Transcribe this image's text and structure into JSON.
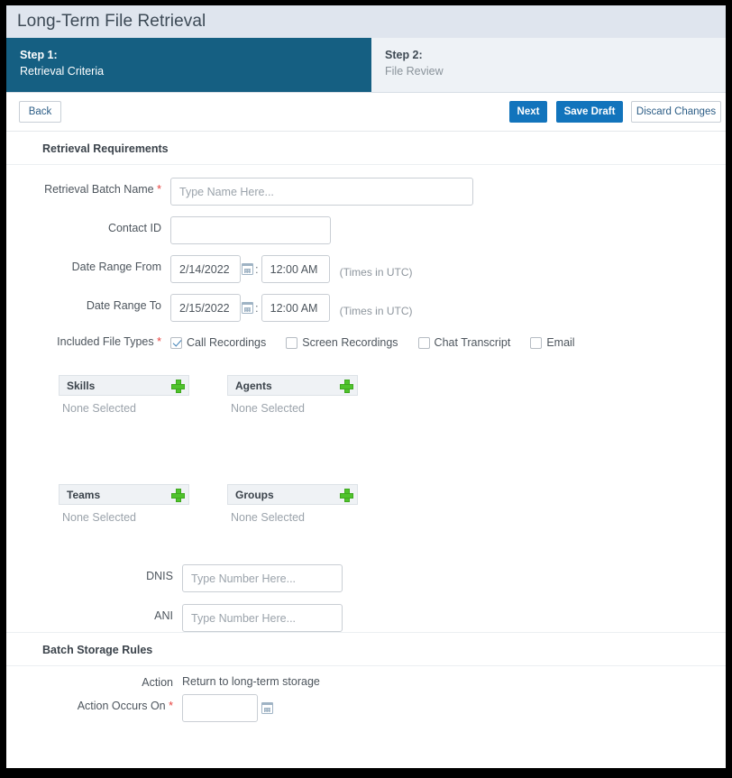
{
  "window": {
    "title": "Long-Term File Retrieval"
  },
  "steps": [
    {
      "num": "Step 1:",
      "name": "Retrieval Criteria",
      "active": true
    },
    {
      "num": "Step 2:",
      "name": "File Review",
      "active": false
    }
  ],
  "toolbar": {
    "back_label": "Back",
    "next_label": "Next",
    "save_draft_label": "Save Draft",
    "discard_label": "Discard Changes"
  },
  "sections": {
    "retrieval": {
      "heading": "Retrieval Requirements",
      "batch_name": {
        "label": "Retrieval Batch Name",
        "required": "*",
        "value": "",
        "placeholder": "Type Name Here..."
      },
      "contact_id": {
        "label": "Contact ID",
        "value": "",
        "placeholder": ""
      },
      "date_from": {
        "label": "Date Range From",
        "date": "2/14/2022",
        "time": "12:00 AM",
        "note": "(Times in UTC)"
      },
      "date_to": {
        "label": "Date Range To",
        "date": "2/15/2022",
        "time": "12:00 AM",
        "note": "(Times in UTC)"
      },
      "file_types": {
        "label": "Included File Types",
        "required": "*",
        "options": [
          {
            "label": "Call Recordings",
            "checked": true
          },
          {
            "label": "Screen Recordings",
            "checked": false
          },
          {
            "label": "Chat Transcript",
            "checked": false
          },
          {
            "label": "Email",
            "checked": false
          }
        ]
      },
      "pickers": [
        {
          "title": "Skills",
          "value": "None Selected"
        },
        {
          "title": "Agents",
          "value": "None Selected"
        },
        {
          "title": "Teams",
          "value": "None Selected"
        },
        {
          "title": "Groups",
          "value": "None Selected"
        }
      ],
      "dnis": {
        "label": "DNIS",
        "value": "",
        "placeholder": "Type Number Here..."
      },
      "ani": {
        "label": "ANI",
        "value": "",
        "placeholder": "Type Number Here..."
      }
    },
    "storage": {
      "heading": "Batch Storage Rules",
      "action": {
        "label": "Action",
        "value": "Return to long-term storage"
      },
      "action_occurs_on": {
        "label": "Action Occurs On",
        "required": "*",
        "value": "",
        "placeholder": ""
      }
    }
  },
  "colors": {
    "title_bar": "#dfe5ee",
    "active_step": "#155f82",
    "inactive_step": "#eef2f6",
    "primary_button": "#1274bc",
    "required_asterisk": "#e8433f",
    "plus_icon": "#4fc32c",
    "checkbox_check": "#3d7fb5"
  }
}
